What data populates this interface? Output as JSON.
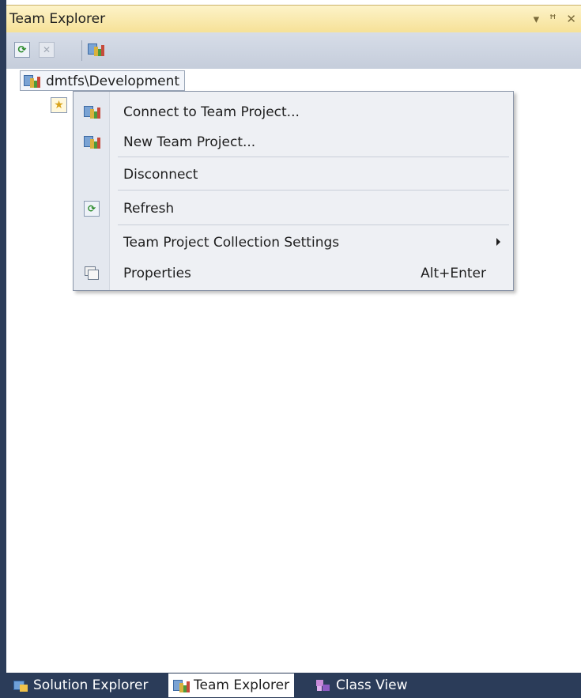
{
  "window": {
    "title": "Team Explorer",
    "ctrl_dropdown": "▾",
    "ctrl_pin": "ꟸ",
    "ctrl_close": "✕"
  },
  "toolbar": {
    "icons": [
      "refresh-icon",
      "stop-icon",
      "connect-server-icon"
    ]
  },
  "tree": {
    "root_label": "dmtfs\\Development",
    "root_icon": "server-icon",
    "child_icon": "favorites-icon"
  },
  "context_menu": {
    "items": [
      {
        "label": "Connect to Team Project...",
        "icon": "connect-icon"
      },
      {
        "label": "New Team Project...",
        "icon": "new-project-icon"
      },
      {
        "label": "Disconnect"
      },
      {
        "label": "Refresh",
        "icon": "refresh-icon"
      },
      {
        "label": "Team Project Collection Settings",
        "submenu": true
      },
      {
        "label": "Properties",
        "icon": "properties-icon",
        "shortcut": "Alt+Enter"
      }
    ]
  },
  "bottom_tabs": [
    {
      "label": "Solution Explorer",
      "icon": "solution-explorer-icon",
      "active": false
    },
    {
      "label": "Team Explorer",
      "icon": "team-explorer-icon",
      "active": true
    },
    {
      "label": "Class View",
      "icon": "class-view-icon",
      "active": false
    }
  ],
  "colors": {
    "title_bar": "#f6e197",
    "toolbar": "#c5cddb",
    "frame_border": "#2b3c59"
  }
}
